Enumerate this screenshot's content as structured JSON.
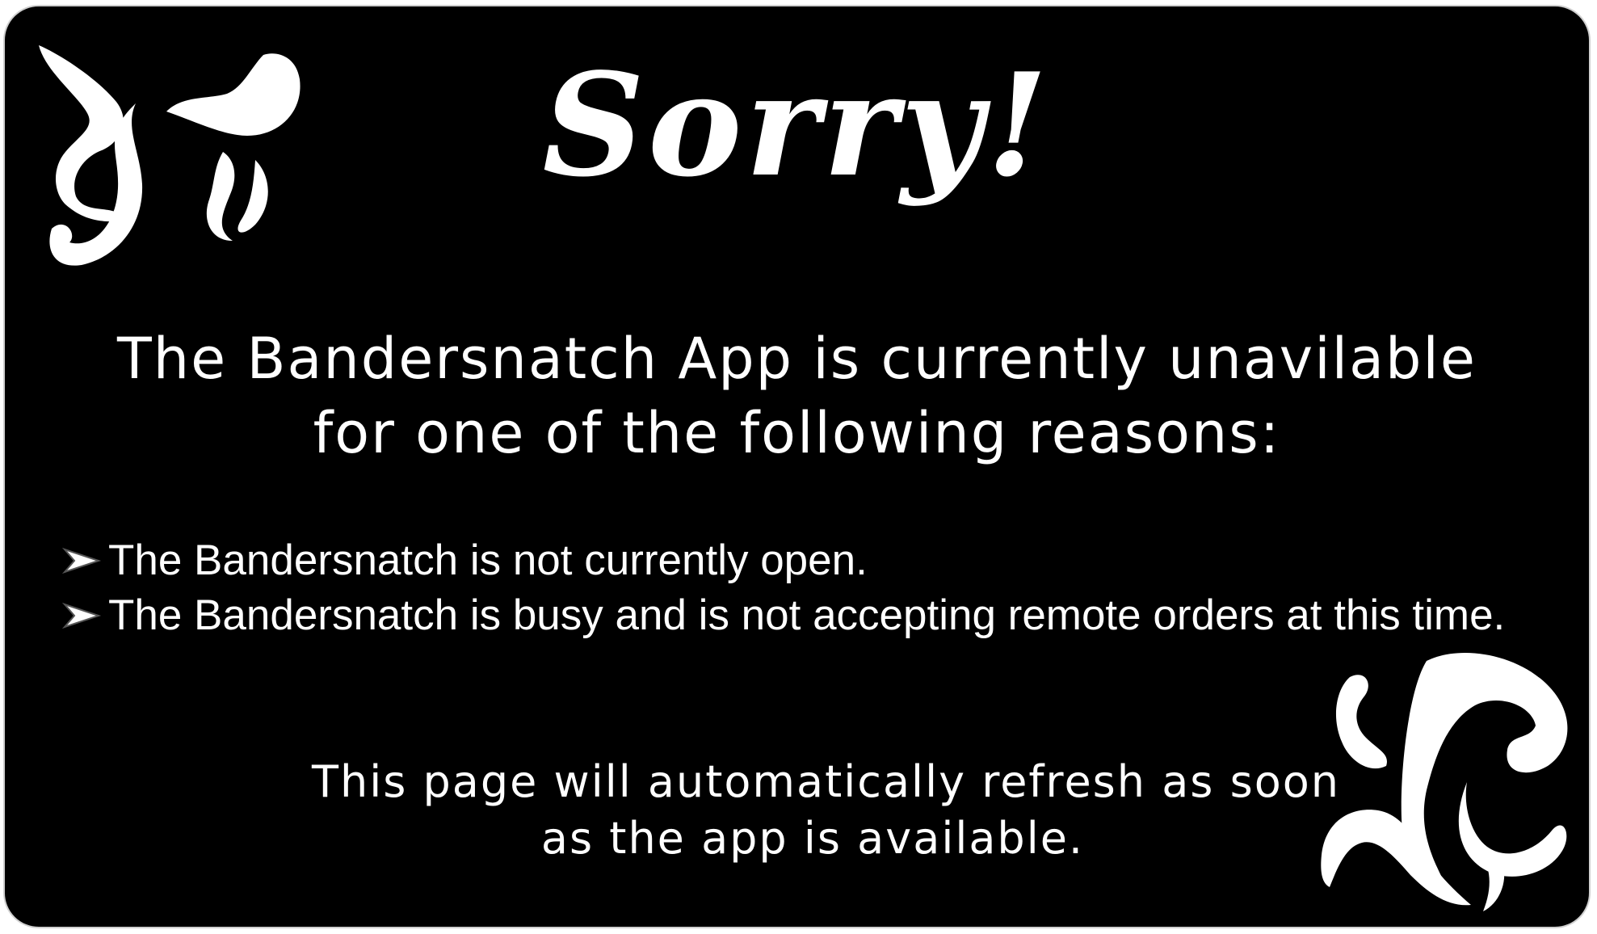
{
  "headline": "Sorry!",
  "intro": {
    "line1": "The Bandersnatch App is currently unavilable",
    "line2": "for one of  the following reasons:"
  },
  "reasons": [
    "The Bandersnatch is not currently open.",
    "The Bandersnatch is busy and is not accepting remote orders at this time."
  ],
  "refresh": {
    "line1": "This page will automatically refresh as soon",
    "line2": "as the app is available."
  },
  "icons": {
    "bullet": "arrow-bullet-icon",
    "decoration": "swirl-ornament-icon"
  },
  "colors": {
    "background": "#000000",
    "text": "#ffffff",
    "border": "#cfcfcf"
  }
}
